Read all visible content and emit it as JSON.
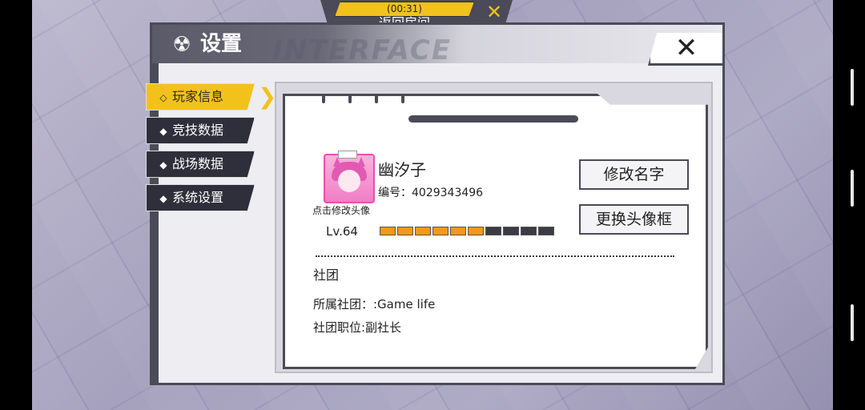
{
  "top_banner": {
    "timer": "(00:31)",
    "label": "返回房间"
  },
  "window": {
    "title": "设置",
    "watermark": "INTERFACE"
  },
  "tabs": [
    {
      "label": "玩家信息",
      "active": true
    },
    {
      "label": "竞技数据",
      "active": false
    },
    {
      "label": "战场数据",
      "active": false
    },
    {
      "label": "系统设置",
      "active": false
    }
  ],
  "player": {
    "avatar_caption": "点击修改头像",
    "name": "幽汐子",
    "id_text": "编号：4029343496",
    "level_text": "Lv.64",
    "exp_fraction": 0.64
  },
  "actions": {
    "rename": "修改名字",
    "change_frame": "更换头像框"
  },
  "club": {
    "title": "社团",
    "affiliation": "所属社团：:Game life",
    "position": "社团职位:副社长"
  },
  "colors": {
    "accent": "#f2c21b",
    "frame": "#4b4b58",
    "exp_on": "#f29a16",
    "exp_off": "#3b3b46"
  }
}
